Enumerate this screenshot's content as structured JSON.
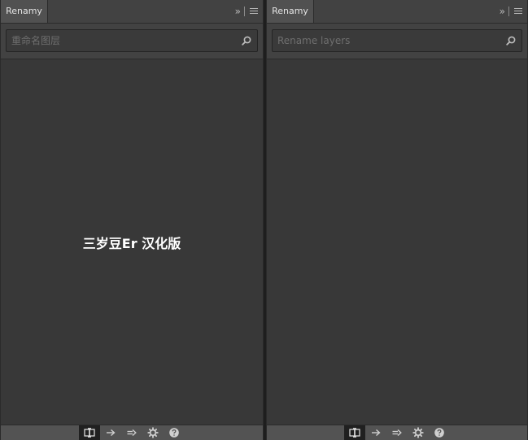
{
  "panels": [
    {
      "tab_label": "Renamy",
      "search_placeholder": "重命名图层",
      "watermark": "三岁豆Er 汉化版"
    },
    {
      "tab_label": "Renamy",
      "search_placeholder": "Rename layers",
      "watermark": ""
    }
  ],
  "header_controls": {
    "collapse_glyph": "»"
  },
  "footer_tools": [
    {
      "icon": "rename-icon",
      "active": true
    },
    {
      "icon": "arrow-right-icon",
      "active": false
    },
    {
      "icon": "double-arrow-right-icon",
      "active": false
    },
    {
      "icon": "gear-icon",
      "active": false
    },
    {
      "icon": "help-icon",
      "active": false
    }
  ],
  "colors": {
    "panel_bg": "#383838",
    "header_bg": "#424242",
    "tab_active_bg": "#515151",
    "footer_bg": "#535353",
    "active_tool_bg": "#202020",
    "text": "#e4e4e4",
    "watermark": "#ffffff"
  }
}
